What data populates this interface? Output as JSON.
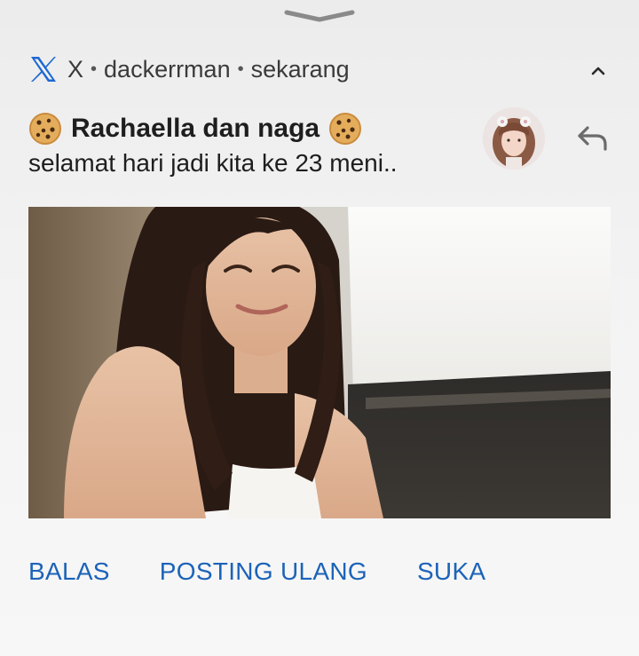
{
  "notification": {
    "app_name": "X",
    "separator": "•",
    "account": "dackerrman",
    "time": "sekarang",
    "title": "Rachaella dan naga",
    "message": "selamat hari jadi kita ke 23 meni..",
    "title_emoji_icon": "cookie-icon"
  },
  "actions": {
    "reply": "BALAS",
    "repost": "POSTING ULANG",
    "like": "SUKA"
  },
  "colors": {
    "action_blue": "#1c63b8",
    "x_logo_blue": "#1d68d3",
    "background": "#f1f1f1"
  },
  "icons": {
    "handle": "chevron-down-handle-icon",
    "collapse": "chevron-up-icon",
    "reply": "reply-arrow-icon"
  }
}
